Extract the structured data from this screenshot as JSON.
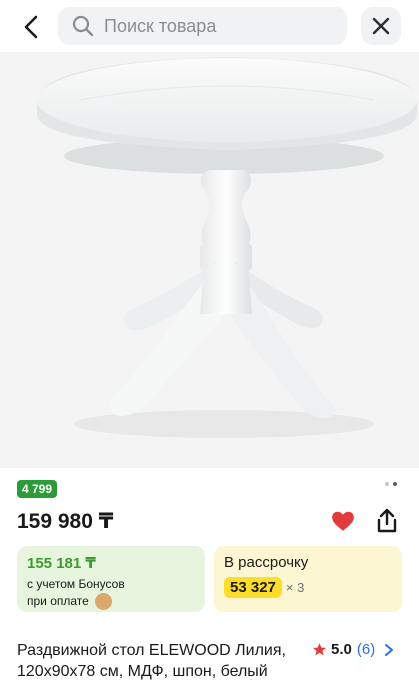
{
  "search": {
    "placeholder": "Поиск товара"
  },
  "product": {
    "bonus_badge": "4 799 ",
    "price": "159 980 ₸",
    "title": "Раздвижной стол ELEWOOD Лилия, 120x90x78 см, МДФ, шпон, белый"
  },
  "bonus_card": {
    "amount": "155 181 ₸",
    "note_line1": "с учетом Бонусов",
    "note_line2": "при оплате"
  },
  "installment_card": {
    "label": "В рассрочку",
    "amount": "53 327",
    "multiplier": "× 3"
  },
  "rating": {
    "score": "5.0",
    "count": "(6)"
  },
  "gallery": {
    "total": 2,
    "active": 1
  },
  "colors": {
    "bonus_green": "#2e9b3a",
    "heart_red": "#e23b3b",
    "installment_yellow": "#fbdd2a",
    "link_blue": "#2e6de0"
  },
  "icons": [
    "back-arrow-icon",
    "search-icon",
    "close-icon",
    "heart-icon",
    "share-icon",
    "star-icon",
    "chevron-right-icon",
    "bonus-coin-icon"
  ]
}
